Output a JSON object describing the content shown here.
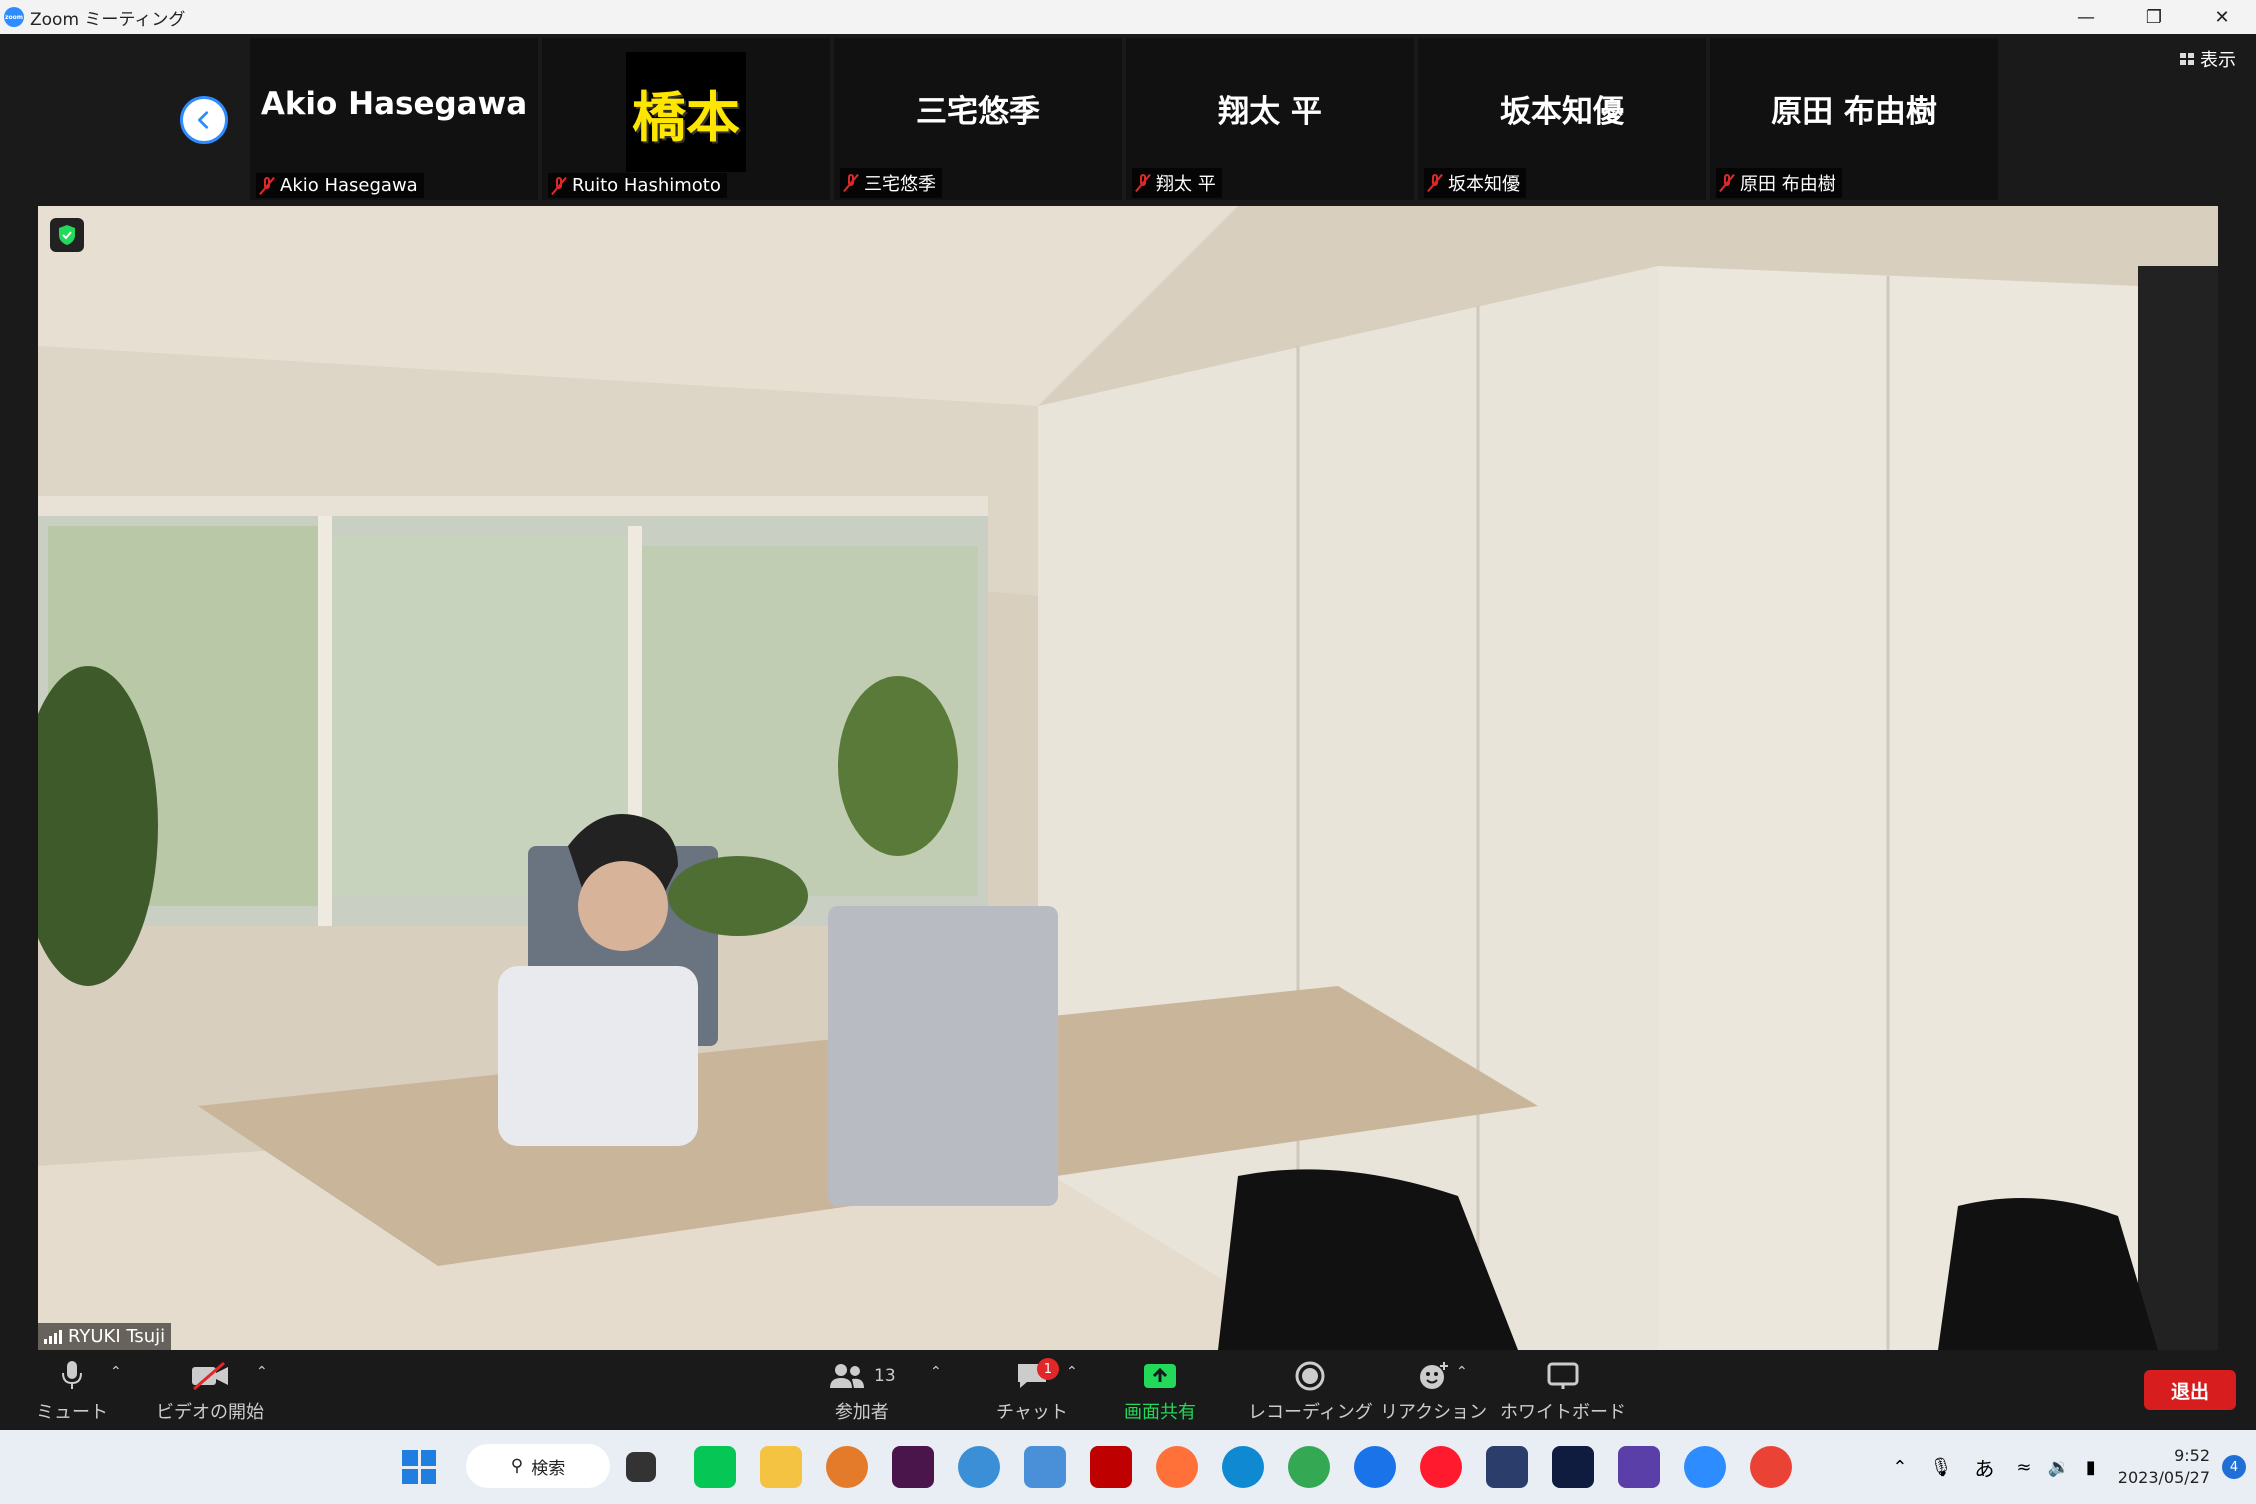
{
  "window": {
    "title": "Zoom ミーティング",
    "app_icon": "zoom-icon",
    "controls": [
      "minimize",
      "restore",
      "close"
    ]
  },
  "view_button": {
    "label": "表示"
  },
  "participants_strip": [
    {
      "display_text": "Akio Hasegawa",
      "name": "Akio Hasegawa",
      "muted": true
    },
    {
      "display_text": "橋本",
      "name": "Ruito Hashimoto",
      "muted": true,
      "has_picture": true
    },
    {
      "display_text": "三宅悠季",
      "name": "三宅悠季",
      "muted": true
    },
    {
      "display_text": "翔太 平",
      "name": "翔太 平",
      "muted": true
    },
    {
      "display_text": "坂本知優",
      "name": "坂本知優",
      "muted": true
    },
    {
      "display_text": "原田 布由樹",
      "name": "原田 布由樹",
      "muted": true
    }
  ],
  "main_speaker": {
    "name": "RYUKI Tsuji",
    "encryption_icon": "shield-check-icon"
  },
  "toolbar": {
    "mute": "ミュート",
    "start_video": "ビデオの開始",
    "participants": "参加者",
    "participants_count": "13",
    "chat": "チャット",
    "chat_badge": "1",
    "share_screen": "画面共有",
    "recording": "レコーディング",
    "reactions": "リアクション",
    "whiteboard": "ホワイトボード",
    "leave": "退出",
    "share_color": "#23d959",
    "leave_color": "#d71d1d"
  },
  "taskbar": {
    "search_label": "検索",
    "ime": "あ",
    "time": "9:52",
    "date": "2023/05/27",
    "notifications": "4",
    "apps": [
      "windows-start-icon",
      "task-view-icon",
      "line-icon",
      "file-explorer-icon",
      "photos-icon",
      "slack-icon",
      "paint-icon",
      "notepad-icon",
      "filezilla-icon",
      "firefox-icon",
      "edge-icon",
      "chrome-icon",
      "thunderbird-icon",
      "opera-icon",
      "app-icon",
      "app-icon-2",
      "3d-app-icon",
      "zoom-icon",
      "chrome-profile-icon"
    ]
  }
}
